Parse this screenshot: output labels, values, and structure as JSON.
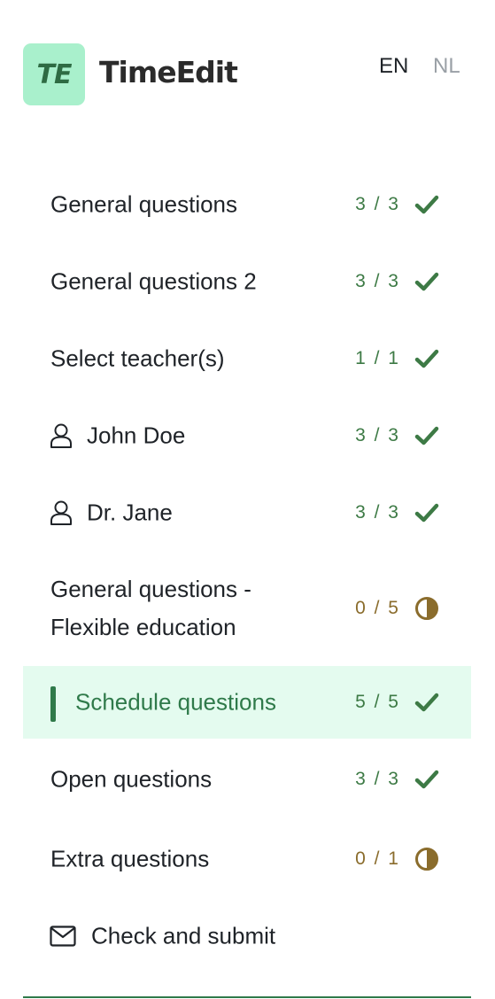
{
  "brand": {
    "logo_mark": "TE",
    "name": "TimeEdit",
    "color": "#a9f0cc"
  },
  "languages": {
    "en": "EN",
    "nl": "NL",
    "active": "EN"
  },
  "nav": {
    "items": [
      {
        "label": "General questions",
        "count": "3 / 3",
        "status": "complete",
        "icon": "check-icon"
      },
      {
        "label": "General questions 2",
        "count": "3 / 3",
        "status": "complete",
        "icon": "check-icon"
      },
      {
        "label": "Select teacher(s)",
        "count": "1 / 1",
        "status": "complete",
        "icon": "check-icon"
      },
      {
        "label": "John Doe",
        "count": "3 / 3",
        "status": "complete",
        "icon": "check-icon",
        "leading_icon": "person-icon"
      },
      {
        "label": "Dr. Jane",
        "count": "3 / 3",
        "status": "complete",
        "icon": "check-icon",
        "leading_icon": "person-icon"
      },
      {
        "label": "General questions - Flexible education",
        "count": "0 / 5",
        "status": "partial",
        "icon": "half-circle-icon"
      },
      {
        "label": "Schedule questions",
        "count": "5 / 5",
        "status": "complete",
        "icon": "check-icon",
        "active": true
      },
      {
        "label": "Open questions",
        "count": "3 / 3",
        "status": "complete",
        "icon": "check-icon"
      },
      {
        "label": "Extra questions",
        "count": "0 / 1",
        "status": "partial",
        "icon": "half-circle-icon"
      }
    ],
    "submit_label": "Check and submit"
  },
  "colors": {
    "accent": "#2f7a4a",
    "active_bg": "#e4fbef",
    "partial": "#8a6c2c",
    "check": "#3d7a45"
  }
}
